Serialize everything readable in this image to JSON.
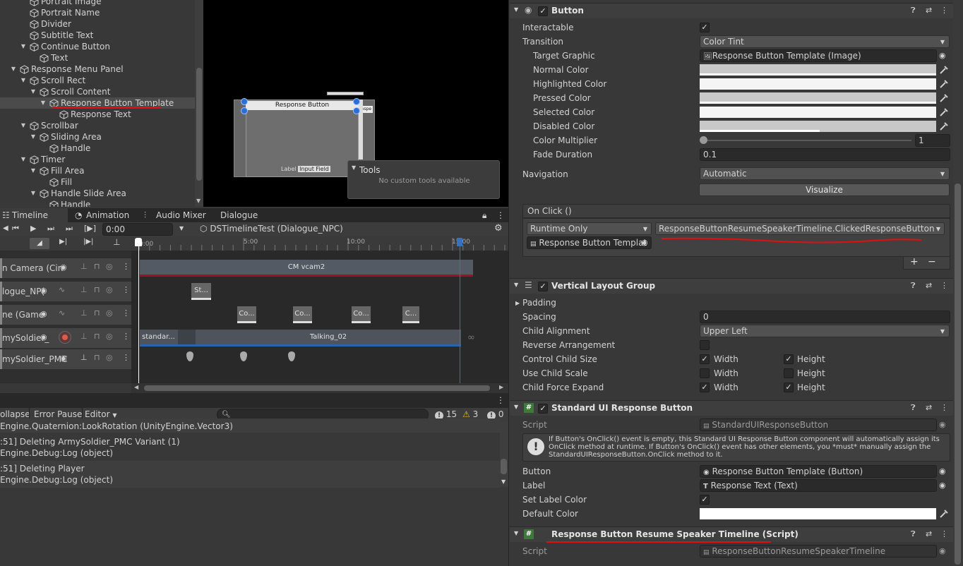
{
  "hierarchy": {
    "items": [
      {
        "label": "Portrait Image",
        "depth": 2,
        "arrow": ""
      },
      {
        "label": "Portrait Name",
        "depth": 2,
        "arrow": ""
      },
      {
        "label": "Divider",
        "depth": 2,
        "arrow": ""
      },
      {
        "label": "Subtitle Text",
        "depth": 2,
        "arrow": ""
      },
      {
        "label": "Continue Button",
        "depth": 2,
        "arrow": "down"
      },
      {
        "label": "Text",
        "depth": 3,
        "arrow": ""
      },
      {
        "label": "Response Menu Panel",
        "depth": 1,
        "arrow": "down"
      },
      {
        "label": "Scroll Rect",
        "depth": 2,
        "arrow": "down"
      },
      {
        "label": "Scroll Content",
        "depth": 3,
        "arrow": "down"
      },
      {
        "label": "Response Button Template",
        "depth": 4,
        "arrow": "down",
        "selected": true
      },
      {
        "label": "Response Text",
        "depth": 5,
        "arrow": ""
      },
      {
        "label": "Scrollbar",
        "depth": 2,
        "arrow": "down"
      },
      {
        "label": "Sliding Area",
        "depth": 3,
        "arrow": "down"
      },
      {
        "label": "Handle",
        "depth": 4,
        "arrow": ""
      },
      {
        "label": "Timer",
        "depth": 2,
        "arrow": "down"
      },
      {
        "label": "Fill Area",
        "depth": 3,
        "arrow": "down"
      },
      {
        "label": "Fill",
        "depth": 4,
        "arrow": ""
      },
      {
        "label": "Handle Slide Area",
        "depth": 3,
        "arrow": "down"
      },
      {
        "label": "Handle",
        "depth": 4,
        "arrow": ""
      }
    ]
  },
  "scene": {
    "button_label": "Response Button",
    "label_text": "Label",
    "input_text": "Input Field",
    "tiny_label": "Inspe",
    "tools_title": "Tools",
    "tools_body": "No custom tools available"
  },
  "timeline": {
    "tabs": [
      "Timeline",
      "Animation",
      "Audio Mixer",
      "Dialogue"
    ],
    "time_value": "0:00",
    "asset": "DSTimelineTest (Dialogue_NPC)",
    "ruler_labels": [
      "0:00",
      "5:00",
      "10:00",
      "15:00"
    ],
    "tracks": [
      {
        "name": "n Camera (Cin",
        "clips": [
          "CM vcam2"
        ]
      },
      {
        "name": "logue_NP(",
        "clips": [
          "St..."
        ]
      },
      {
        "name": "ne (Game",
        "clips": [
          "Co...",
          "Co...",
          "Co...",
          "C..."
        ]
      },
      {
        "name": "mySoldier_",
        "clips": [
          "standar...",
          "Talking_02"
        ]
      },
      {
        "name": "mySoldier_PMC",
        "clips": []
      }
    ]
  },
  "console": {
    "buttons": [
      "ollapse",
      "Error Pause",
      "Editor"
    ],
    "counts": {
      "log": "15",
      "warn": "3",
      "error": "0"
    },
    "lines": [
      {
        "a": "Engine.Quaternion:LookRotation (UnityEngine.Vector3)",
        "b": ""
      },
      {
        "a": ":51] Deleting ArmySoldier_PMC Variant (1)",
        "b": "Engine.Debug:Log (object)"
      },
      {
        "a": ":51] Deleting Player",
        "b": "Engine.Debug:Log (object)"
      }
    ]
  },
  "inspector": {
    "button": {
      "title": "Button",
      "interactable": "Interactable",
      "transition": "Transition",
      "transition_value": "Color Tint",
      "target_graphic": "Target Graphic",
      "target_graphic_value": "Response Button Template (Image)",
      "normal": "Normal Color",
      "highlighted": "Highlighted Color",
      "pressed": "Pressed Color",
      "selected": "Selected Color",
      "disabled": "Disabled Color",
      "multiplier": "Color Multiplier",
      "multiplier_value": "1",
      "fade": "Fade Duration",
      "fade_value": "0.1",
      "navigation": "Navigation",
      "navigation_value": "Automatic",
      "visualize": "Visualize",
      "onclick": "On Click ()",
      "runtime": "Runtime Only",
      "function": "ResponseButtonResumeSpeakerTimeline.ClickedResponseButton",
      "object": "Response Button Templat",
      "plus": "+",
      "minus": "−"
    },
    "vlg": {
      "title": "Vertical Layout Group",
      "padding": "Padding",
      "spacing": "Spacing",
      "spacing_value": "0",
      "alignment": "Child Alignment",
      "alignment_value": "Upper Left",
      "reverse": "Reverse Arrangement",
      "control": "Control Child Size",
      "scale": "Use Child Scale",
      "expand": "Child Force Expand",
      "width": "Width",
      "height": "Height"
    },
    "std": {
      "title": "Standard UI Response Button",
      "script": "Script",
      "script_value": "StandardUIResponseButton",
      "help1": "If Button's OnClick() event is empty, this Standard UI Response Button component will automatically assign its",
      "help2": "OnClick method at runtime. If Button's OnClick() event has other elements, you *must* manually assign the",
      "help3": "StandardUIResponseButton.OnClick method to it.",
      "button": "Button",
      "button_value": "Response Button Template (Button)",
      "label": "Label",
      "label_value": "Response Text (Text)",
      "set_label": "Set Label Color",
      "default_color": "Default Color"
    },
    "resume": {
      "title": "Response Button Resume Speaker Timeline (Script)",
      "script": "Script",
      "script_value": "ResponseButtonResumeSpeakerTimeline"
    }
  },
  "colors": {
    "red_annotation": "#e01010",
    "selection": "#4b4b4b",
    "clip_blue": "#2d63a8"
  }
}
